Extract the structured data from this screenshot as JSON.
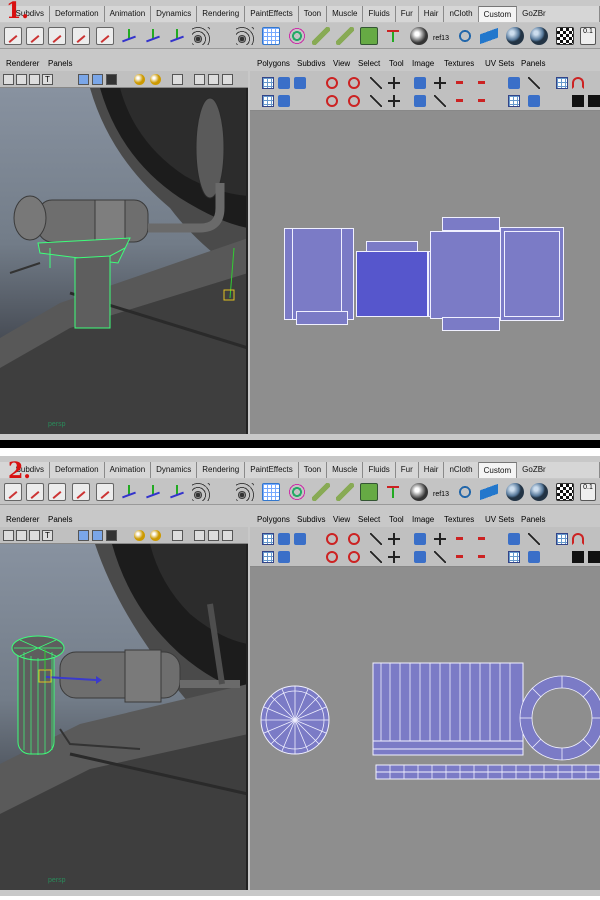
{
  "steps": [
    {
      "step_label": "1.",
      "shelf_tabs": [
        "Subdivs",
        "Deformation",
        "Animation",
        "Dynamics",
        "Rendering",
        "PaintEffects",
        "Toon",
        "Muscle",
        "Fluids",
        "Fur",
        "Hair",
        "nCloth",
        "Custom",
        "GoZBr"
      ],
      "active_tab": "Custom",
      "viewport": {
        "menus": [
          "Renderer",
          "Panels"
        ],
        "camera_label": "persp"
      },
      "uv_editor": {
        "menus": [
          "Polygons",
          "Subdivs",
          "View",
          "Select",
          "Tool",
          "Image",
          "Textures",
          "UV Sets",
          "Panels"
        ]
      }
    },
    {
      "step_label": "2.",
      "shelf_tabs": [
        "Subdivs",
        "Deformation",
        "Animation",
        "Dynamics",
        "Rendering",
        "PaintEffects",
        "Toon",
        "Muscle",
        "Fluids",
        "Fur",
        "Hair",
        "nCloth",
        "Custom",
        "GoZBr"
      ],
      "active_tab": "Custom",
      "viewport": {
        "menus": [
          "Renderer",
          "Panels"
        ],
        "camera_label": "persp"
      },
      "uv_editor": {
        "menus": [
          "Polygons",
          "Subdivs",
          "View",
          "Select",
          "Tool",
          "Image",
          "Textures",
          "UV Sets",
          "Panels"
        ]
      }
    }
  ],
  "shelf_icon_text": "ref13",
  "shelf_icon_text_2": "0.1",
  "colors": {
    "uv_shell": "#7b7bc6",
    "uv_shell_selected": "#5656cc",
    "uv_background": "#8e8e8e",
    "selection_wireframe": "#3dff7a",
    "step_label": "#d81010"
  },
  "icons": [
    "new-scene-icon",
    "paint-icon",
    "joint-axis-icon",
    "radar-icon",
    "uv-cube-icon",
    "spiral-icon",
    "brush-icon",
    "box-icon",
    "rig-icon",
    "render-sphere-icon",
    "refresh-icon",
    "arrow-icon",
    "globe-icon",
    "checker-icon"
  ]
}
